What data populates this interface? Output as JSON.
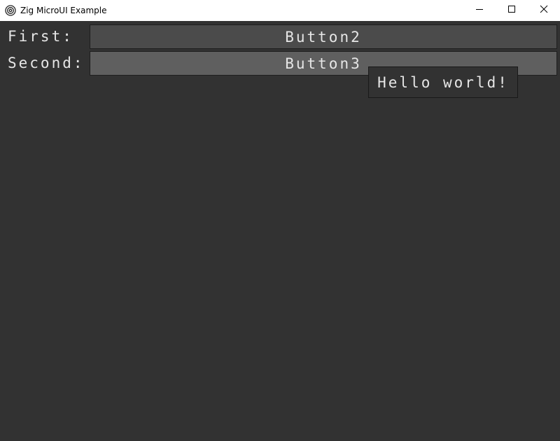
{
  "window": {
    "title": "Zig MicroUI Example",
    "controls": {
      "minimize": "minimize",
      "maximize": "maximize",
      "close": "close"
    }
  },
  "rows": [
    {
      "label": "First:",
      "button": "Button2"
    },
    {
      "label": "Second:",
      "button": "Button3"
    }
  ],
  "tooltip": {
    "text": "Hello world!"
  },
  "colors": {
    "background": "#323232",
    "button": "#4b4b4b",
    "button_hover": "#5f5f5f",
    "text": "#e6e6e6"
  }
}
